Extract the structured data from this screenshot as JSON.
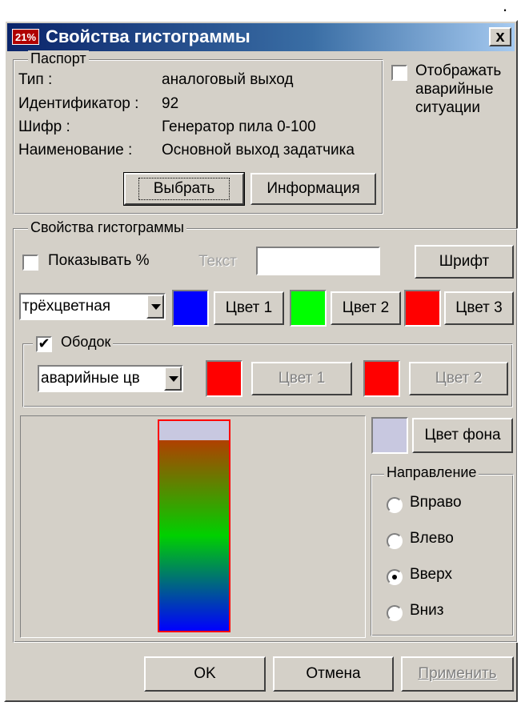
{
  "corner_mark": ".",
  "window": {
    "title": "Свойства гистограммы",
    "icon_text": "21%",
    "close_label": "x"
  },
  "passport": {
    "legend": "Паспорт",
    "rows": [
      {
        "label": "Тип :",
        "value": "аналоговый выход"
      },
      {
        "label": "Идентификатор :",
        "value": "92"
      },
      {
        "label": "Шифр :",
        "value": "Генератор пила 0-100"
      },
      {
        "label": "Наименование :",
        "value": "Основной выход задатчика"
      }
    ],
    "select_button": "Выбрать",
    "info_button": "Информация"
  },
  "alarm": {
    "checked": false,
    "label_lines": [
      "Отображать",
      "аварийные",
      "ситуации"
    ]
  },
  "histogram": {
    "legend": "Свойства гистограммы",
    "show_percent_label": "Показывать %",
    "show_percent_checked": false,
    "text_label": "Текст",
    "text_value": "",
    "font_button": "Шрифт",
    "color_mode": "трёхцветная",
    "color1": {
      "label": "Цвет 1",
      "color": "#0000ff"
    },
    "color2": {
      "label": "Цвет 2",
      "color": "#00ff00"
    },
    "color3": {
      "label": "Цвет 3",
      "color": "#ff0000"
    }
  },
  "border": {
    "legend": "Ободок",
    "checked": true,
    "mode": "аварийные цв",
    "color1": {
      "label": "Цвет 1",
      "color": "#ff0000"
    },
    "color2": {
      "label": "Цвет 2",
      "color": "#ff0000"
    }
  },
  "preview": {
    "fill_fraction": 0.91,
    "background_color": "#c8c8e0",
    "border_color": "#ff0000"
  },
  "background": {
    "button": "Цвет фона",
    "color": "#c8c8e0"
  },
  "direction": {
    "legend": "Направление",
    "options": [
      {
        "label": "Вправо",
        "selected": false
      },
      {
        "label": "Влево",
        "selected": false
      },
      {
        "label": "Вверх",
        "selected": true
      },
      {
        "label": "Вниз",
        "selected": false
      }
    ]
  },
  "footer": {
    "ok": "OK",
    "cancel": "Отмена",
    "apply": "Применить"
  }
}
